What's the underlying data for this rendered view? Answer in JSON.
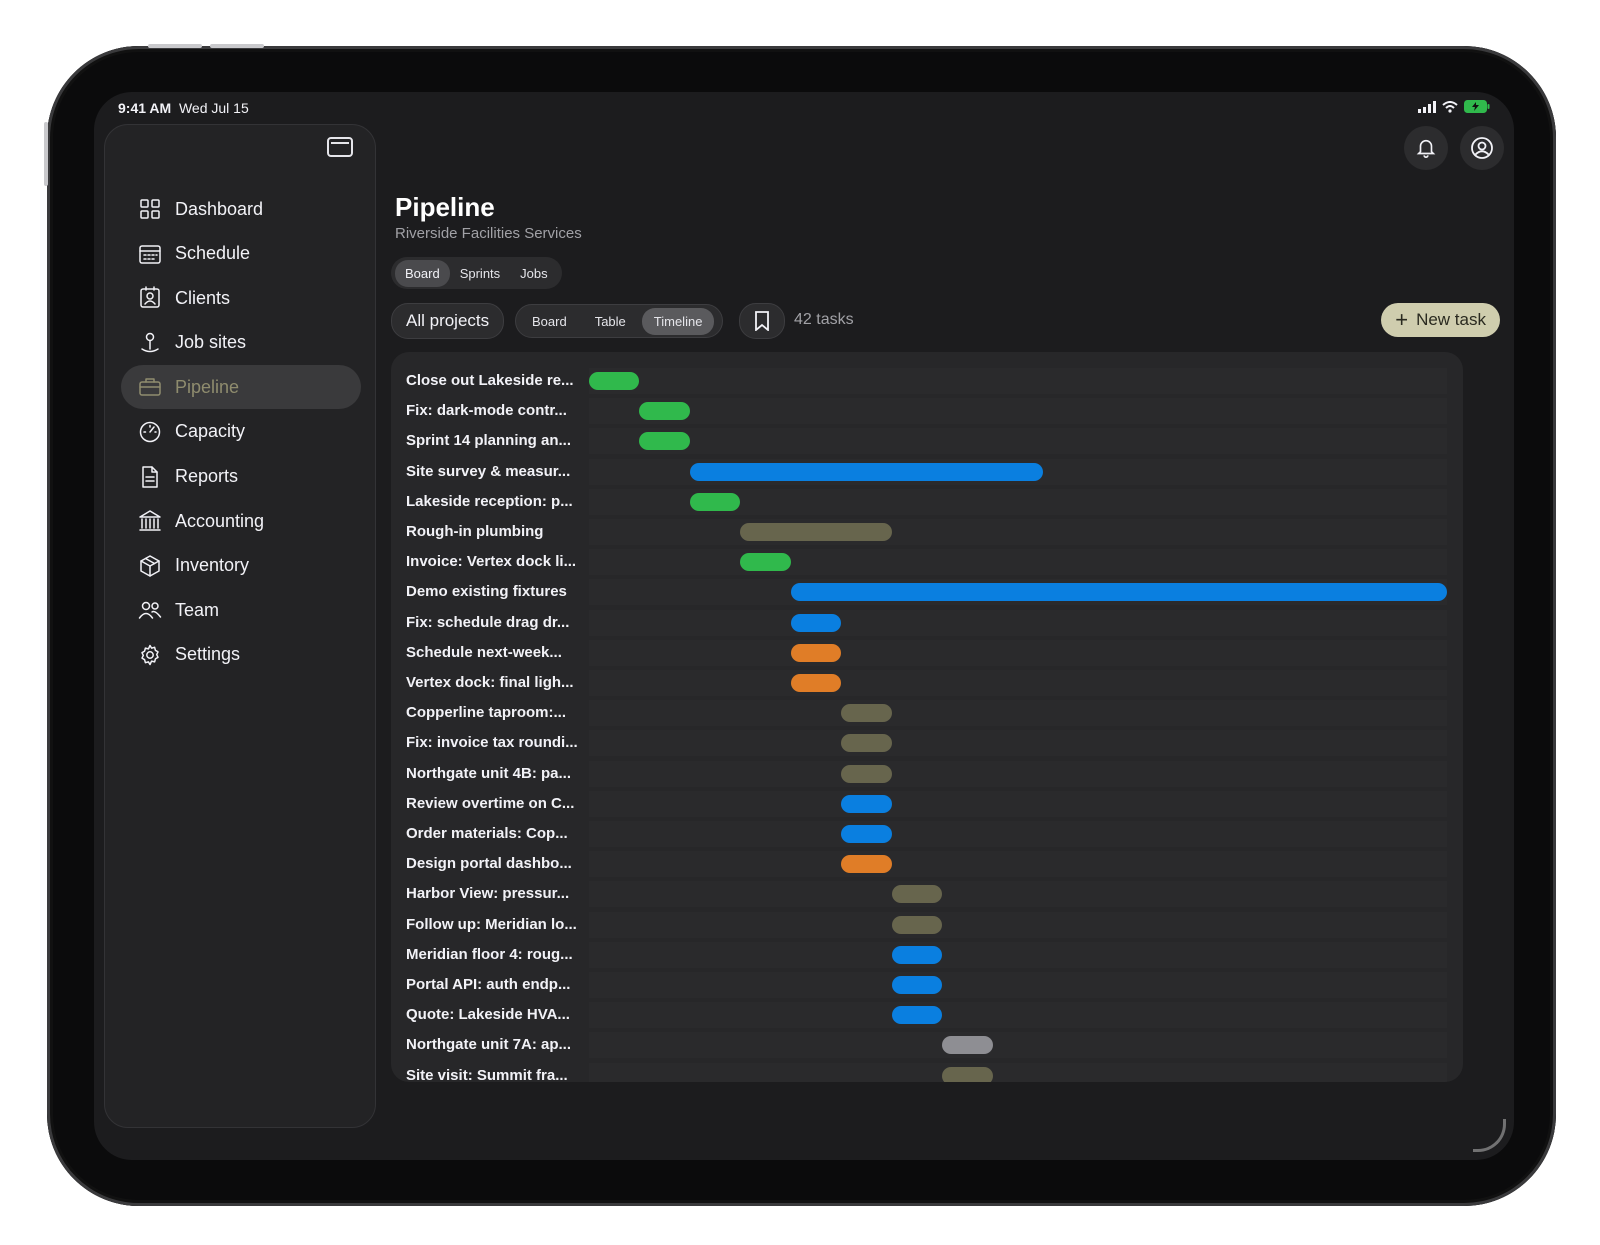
{
  "status": {
    "time": "9:41 AM",
    "date": "Wed Jul 15"
  },
  "sidebar": {
    "items": [
      {
        "label": "Dashboard",
        "icon": "dashboard-icon",
        "active": false
      },
      {
        "label": "Schedule",
        "icon": "calendar-icon",
        "active": false
      },
      {
        "label": "Clients",
        "icon": "contact-card-icon",
        "active": false
      },
      {
        "label": "Job sites",
        "icon": "location-pin-icon",
        "active": false
      },
      {
        "label": "Pipeline",
        "icon": "briefcase-icon",
        "active": true
      },
      {
        "label": "Capacity",
        "icon": "gauge-icon",
        "active": false
      },
      {
        "label": "Reports",
        "icon": "document-icon",
        "active": false
      },
      {
        "label": "Accounting",
        "icon": "bank-icon",
        "active": false
      },
      {
        "label": "Inventory",
        "icon": "box-icon",
        "active": false
      },
      {
        "label": "Team",
        "icon": "people-icon",
        "active": false
      },
      {
        "label": "Settings",
        "icon": "gear-icon",
        "active": false
      }
    ]
  },
  "header": {
    "title": "Pipeline",
    "subtitle": "Riverside Facilities Services"
  },
  "view_tabs": {
    "items": [
      "Board",
      "Sprints",
      "Jobs"
    ],
    "selected": "Board"
  },
  "toolbar": {
    "project_filter": "All projects",
    "layouts": [
      "Board",
      "Table",
      "Timeline"
    ],
    "layout_selected": "Timeline",
    "task_count": "42 tasks",
    "new_task_label": "New task"
  },
  "colors": {
    "green": "#30b94c",
    "blue": "#0a7fe0",
    "orange": "#e07d27",
    "olive": "#67654d",
    "gray": "#8e8e93",
    "accent": "#cfcdae"
  },
  "timeline": {
    "slot_count": 17,
    "tasks": [
      {
        "label": "Close out Lakeside re...",
        "start": 0,
        "span": 1,
        "color": "green"
      },
      {
        "label": "Fix: dark-mode contr...",
        "start": 1,
        "span": 1,
        "color": "green"
      },
      {
        "label": "Sprint 14 planning an...",
        "start": 1,
        "span": 1,
        "color": "green"
      },
      {
        "label": "Site survey & measur...",
        "start": 2,
        "span": 7,
        "color": "blue"
      },
      {
        "label": "Lakeside reception: p...",
        "start": 2,
        "span": 1,
        "color": "green"
      },
      {
        "label": "Rough-in plumbing",
        "start": 3,
        "span": 3,
        "color": "olive"
      },
      {
        "label": "Invoice: Vertex dock li...",
        "start": 3,
        "span": 1,
        "color": "green"
      },
      {
        "label": "Demo existing fixtures",
        "start": 4,
        "span": 13,
        "color": "blue"
      },
      {
        "label": "Fix: schedule drag dr...",
        "start": 4,
        "span": 1,
        "color": "blue"
      },
      {
        "label": "Schedule next-week...",
        "start": 4,
        "span": 1,
        "color": "orange"
      },
      {
        "label": "Vertex dock: final ligh...",
        "start": 4,
        "span": 1,
        "color": "orange"
      },
      {
        "label": "Copperline taproom:...",
        "start": 5,
        "span": 1,
        "color": "olive"
      },
      {
        "label": "Fix: invoice tax roundi...",
        "start": 5,
        "span": 1,
        "color": "olive"
      },
      {
        "label": "Northgate unit 4B: pa...",
        "start": 5,
        "span": 1,
        "color": "olive"
      },
      {
        "label": "Review overtime on C...",
        "start": 5,
        "span": 1,
        "color": "blue"
      },
      {
        "label": "Order materials: Cop...",
        "start": 5,
        "span": 1,
        "color": "blue"
      },
      {
        "label": "Design portal dashbo...",
        "start": 5,
        "span": 1,
        "color": "orange"
      },
      {
        "label": "Harbor View: pressur...",
        "start": 6,
        "span": 1,
        "color": "olive"
      },
      {
        "label": "Follow up: Meridian lo...",
        "start": 6,
        "span": 1,
        "color": "olive"
      },
      {
        "label": "Meridian floor 4: roug...",
        "start": 6,
        "span": 1,
        "color": "blue"
      },
      {
        "label": "Portal API: auth endp...",
        "start": 6,
        "span": 1,
        "color": "blue"
      },
      {
        "label": "Quote: Lakeside HVA...",
        "start": 6,
        "span": 1,
        "color": "blue"
      },
      {
        "label": "Northgate unit 7A: ap...",
        "start": 7,
        "span": 1,
        "color": "gray"
      },
      {
        "label": "Site visit: Summit fra...",
        "start": 7,
        "span": 1,
        "color": "olive"
      }
    ]
  }
}
